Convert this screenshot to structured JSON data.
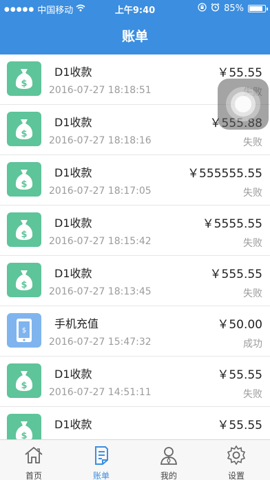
{
  "status_bar": {
    "signal": "●●●●●",
    "carrier": "中国移动",
    "wifi": "wifi-icon",
    "time": "上午9:40",
    "battery_percent": "85%",
    "battery_level": 0.85
  },
  "nav": {
    "title": "账单"
  },
  "bills": [
    {
      "icon": "money-bag-icon",
      "name": "D1收款",
      "time": "2016-07-27 18:18:51",
      "amount": "￥55.55",
      "status": "失败"
    },
    {
      "icon": "money-bag-icon",
      "name": "D1收款",
      "time": "2016-07-27 18:18:16",
      "amount": "￥555.88",
      "status": "失败"
    },
    {
      "icon": "money-bag-icon",
      "name": "D1收款",
      "time": "2016-07-27 18:17:05",
      "amount": "￥555555.55",
      "status": "失败"
    },
    {
      "icon": "money-bag-icon",
      "name": "D1收款",
      "time": "2016-07-27 18:15:42",
      "amount": "￥5555.55",
      "status": "失败"
    },
    {
      "icon": "money-bag-icon",
      "name": "D1收款",
      "time": "2016-07-27 18:13:45",
      "amount": "￥555.55",
      "status": "失败"
    },
    {
      "icon": "phone-recharge-icon",
      "name": "手机充值",
      "time": "2016-07-27 15:47:32",
      "amount": "￥50.00",
      "status": "成功"
    },
    {
      "icon": "money-bag-icon",
      "name": "D1收款",
      "time": "2016-07-27 14:51:11",
      "amount": "￥55.55",
      "status": "失败"
    },
    {
      "icon": "money-bag-icon",
      "name": "D1收款",
      "time": "",
      "amount": "￥55.55",
      "status": ""
    }
  ],
  "tabs": [
    {
      "label": "首页",
      "icon": "home-icon",
      "active": false
    },
    {
      "label": "账单",
      "icon": "bill-icon",
      "active": true
    },
    {
      "label": "我的",
      "icon": "user-icon",
      "active": false
    },
    {
      "label": "设置",
      "icon": "gear-icon",
      "active": false
    }
  ],
  "colors": {
    "accent": "#3b8ee0",
    "money_icon_bg": "#5ec49a",
    "phone_icon_bg": "#7fb4ee",
    "muted_text": "#9b9b9b"
  }
}
